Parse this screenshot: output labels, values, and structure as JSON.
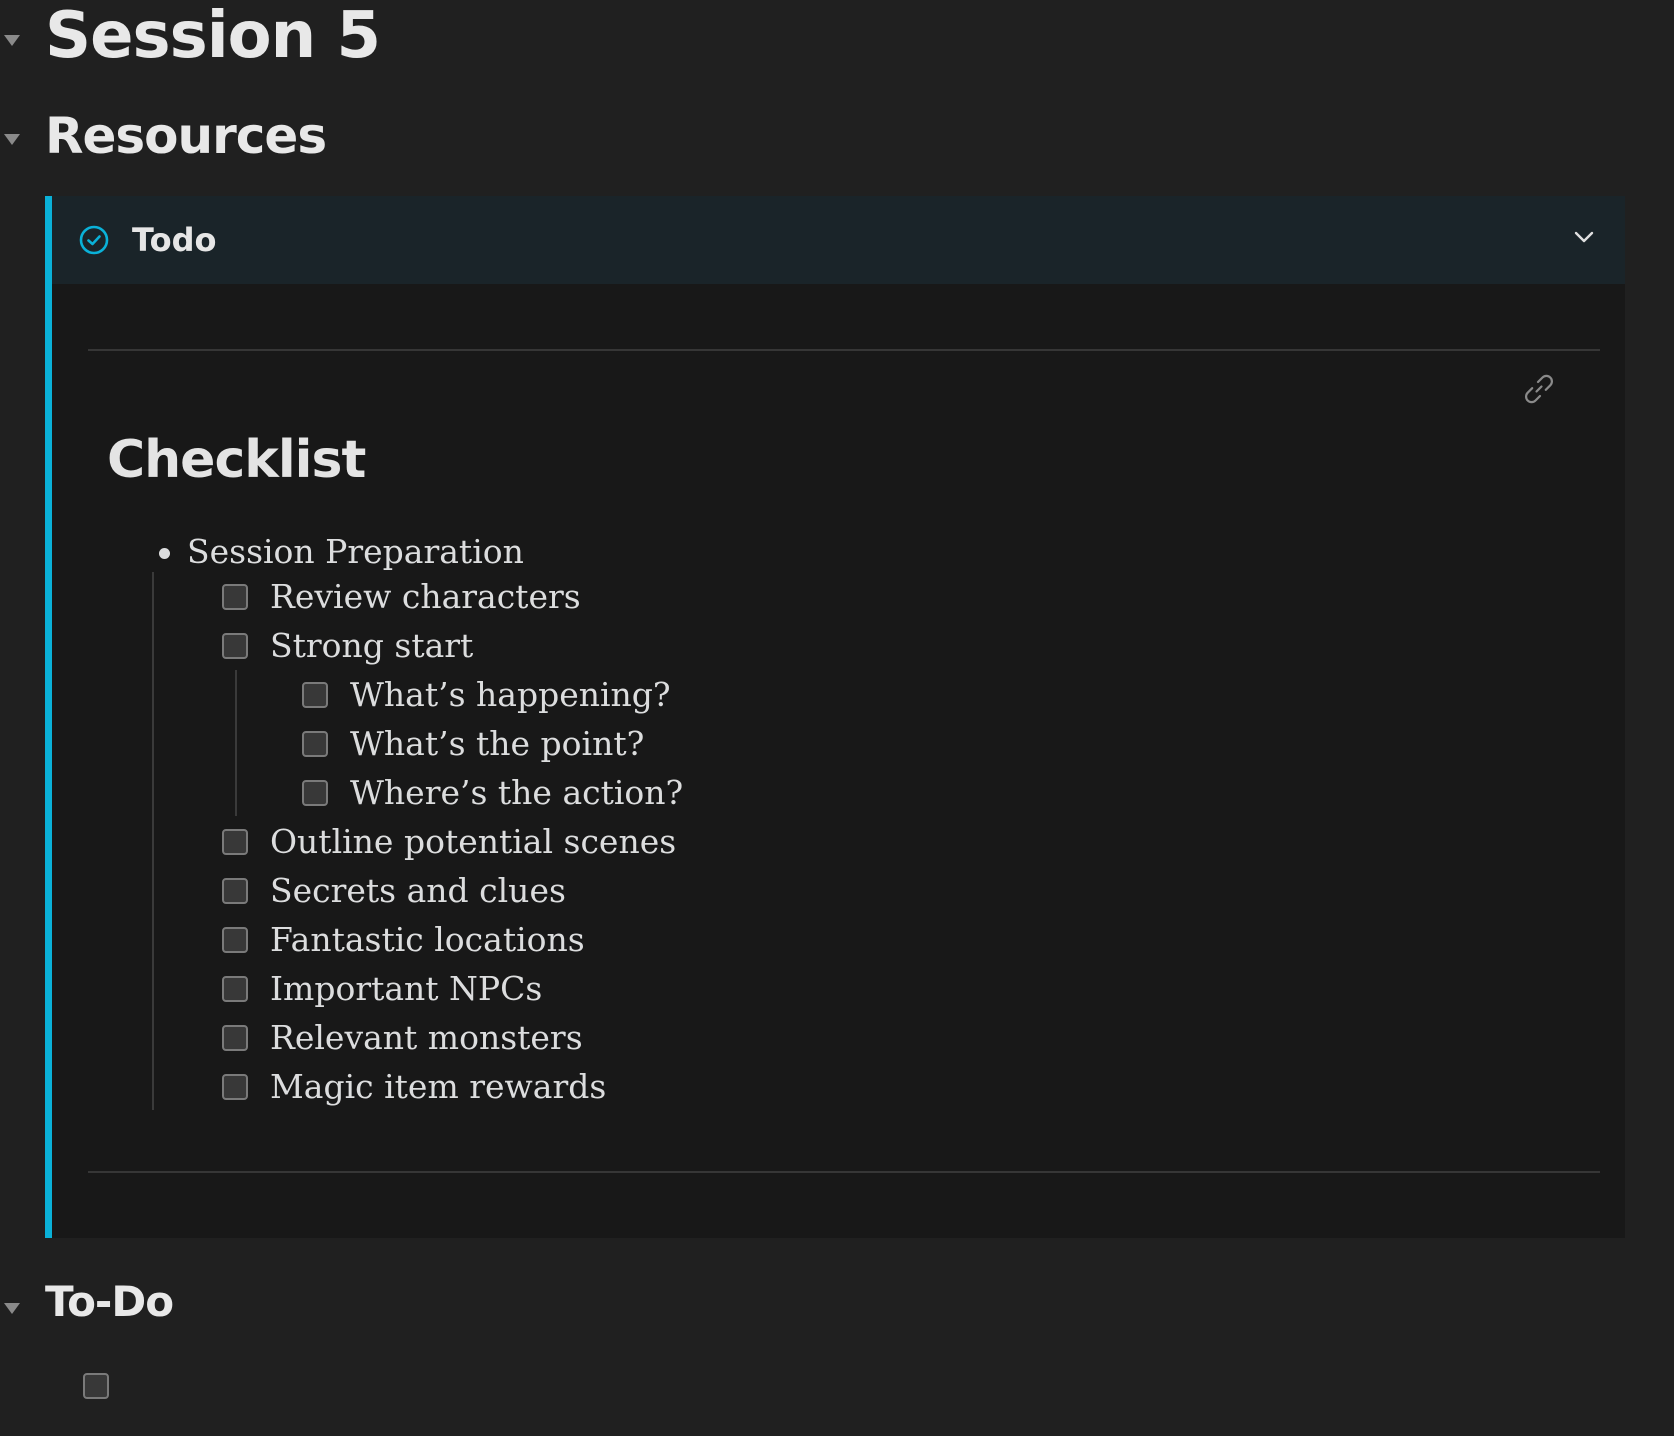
{
  "headings": {
    "session": "Session 5",
    "resources": "Resources",
    "todo": "To-Do"
  },
  "callout": {
    "title": "Todo",
    "accent_color": "#0ab1d8",
    "icon": "check-circle-icon",
    "collapse_icon": "chevron-down-icon"
  },
  "checklist": {
    "title": "Checklist",
    "root_item": "Session Preparation",
    "items": [
      {
        "label": "Review characters",
        "checked": false
      },
      {
        "label": "Strong start",
        "checked": false,
        "children": [
          {
            "label": "What’s happening?",
            "checked": false
          },
          {
            "label": "What’s the point?",
            "checked": false
          },
          {
            "label": "Where’s the action?",
            "checked": false
          }
        ]
      },
      {
        "label": "Outline potential scenes",
        "checked": false
      },
      {
        "label": "Secrets and clues",
        "checked": false
      },
      {
        "label": "Fantastic locations",
        "checked": false
      },
      {
        "label": "Important NPCs",
        "checked": false
      },
      {
        "label": "Relevant monsters",
        "checked": false
      },
      {
        "label": "Magic item rewards",
        "checked": false
      }
    ]
  },
  "todo_section": {
    "empty_task_checked": false
  }
}
